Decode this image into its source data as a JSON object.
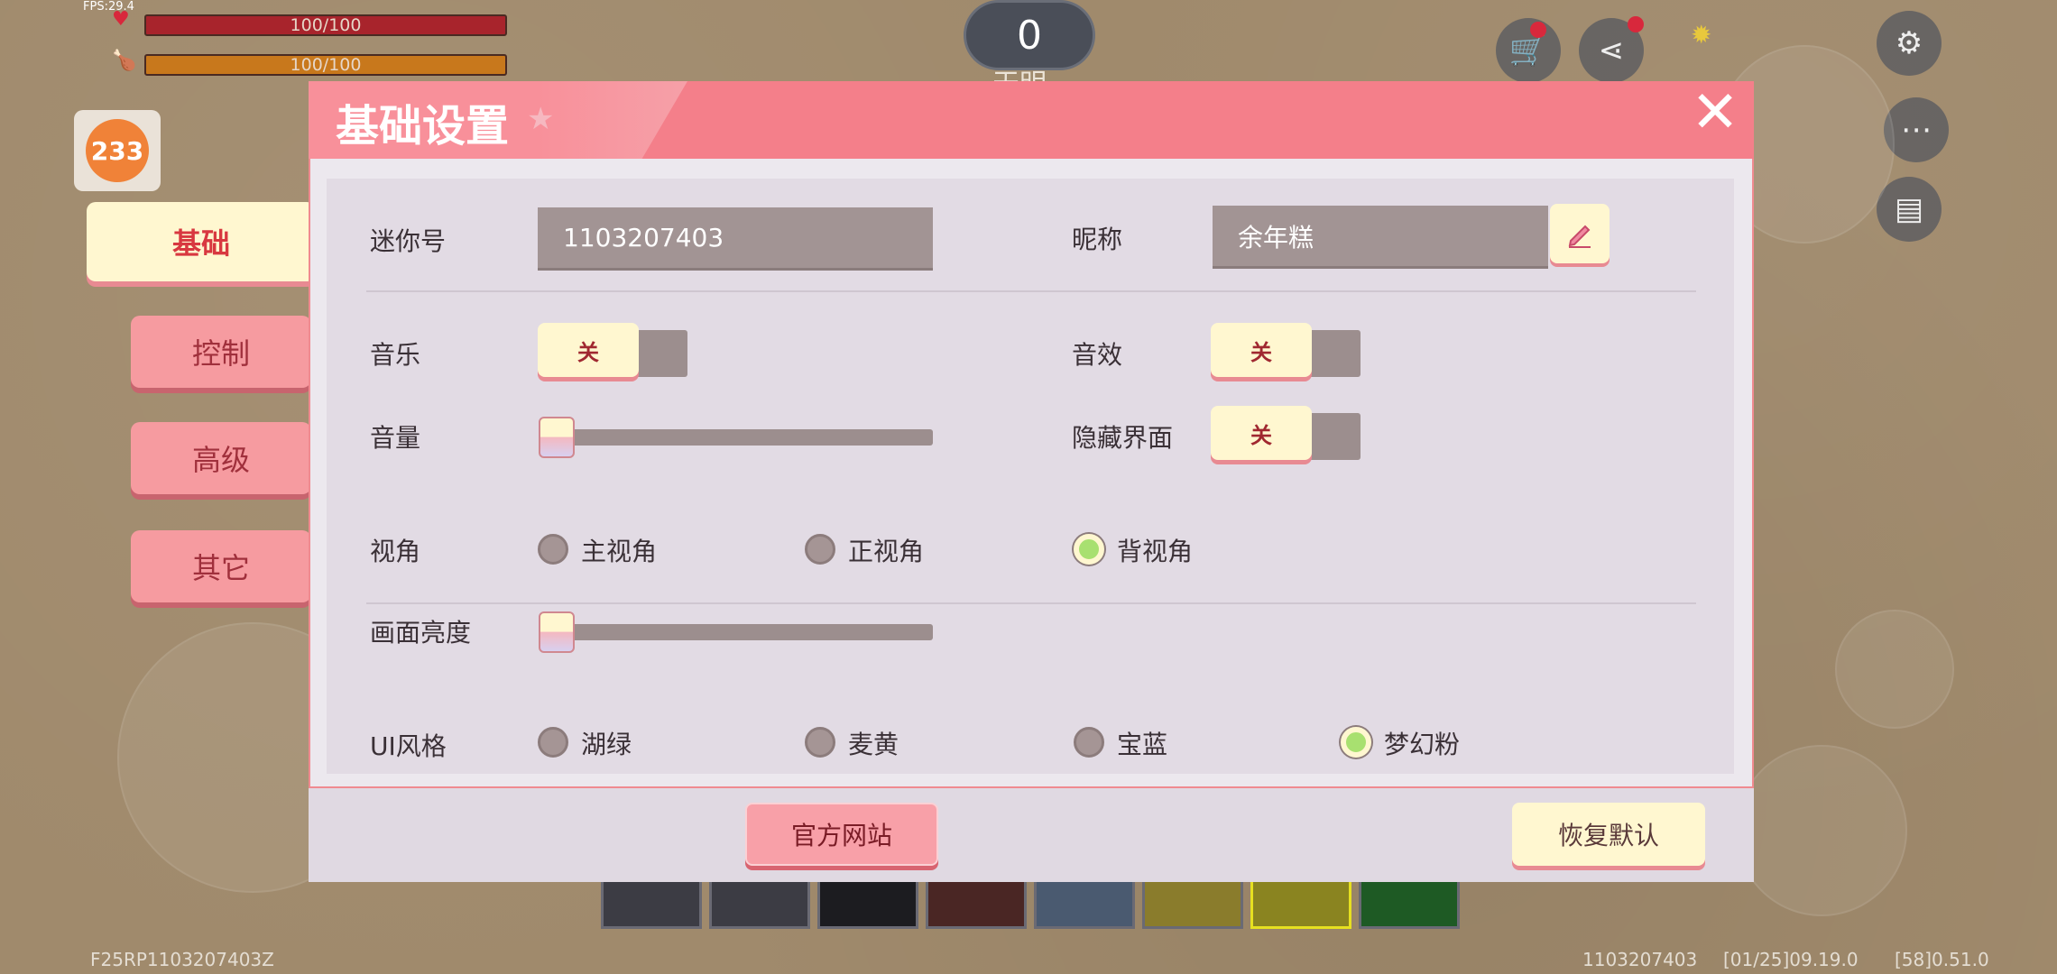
{
  "hud": {
    "fps": "FPS:29.4",
    "health": "100/100",
    "hunger": "100/100",
    "score": "0",
    "score_sub": "天明",
    "level_badge": "233",
    "bottom_left": "F25RP1103207403Z",
    "bottom_right_id": "1103207403",
    "bottom_coord1": "[01/25]09.19.0",
    "bottom_coord2": "[58]0.51.0"
  },
  "side_tabs": [
    {
      "label": "基础",
      "active": true
    },
    {
      "label": "控制",
      "active": false
    },
    {
      "label": "高级",
      "active": false
    },
    {
      "label": "其它",
      "active": false
    }
  ],
  "dialog": {
    "title": "基础设置",
    "close_glyph": "✕",
    "mini_id_label": "迷你号",
    "mini_id_value": "1103207403",
    "nickname_label": "昵称",
    "nickname_value": "余年糕",
    "music_label": "音乐",
    "music_state": "关",
    "sfx_label": "音效",
    "sfx_state": "关",
    "volume_label": "音量",
    "volume_value": 0,
    "hide_ui_label": "隐藏界面",
    "hide_ui_state": "关",
    "view_label": "视角",
    "view_options": [
      "主视角",
      "正视角",
      "背视角"
    ],
    "view_selected": 2,
    "brightness_label": "画面亮度",
    "brightness_value": 0,
    "ui_style_label": "UI风格",
    "ui_style_options": [
      "湖绿",
      "麦黄",
      "宝蓝",
      "梦幻粉"
    ],
    "ui_style_selected": 3,
    "official_site_button": "官方网站",
    "restore_default_button": "恢复默认"
  },
  "colors": {
    "accent_pink": "#f47f8a",
    "cream": "#fff7d0",
    "panel": "#e2dbe4",
    "field": "#a29494",
    "radio_selected": "#a8e070"
  }
}
